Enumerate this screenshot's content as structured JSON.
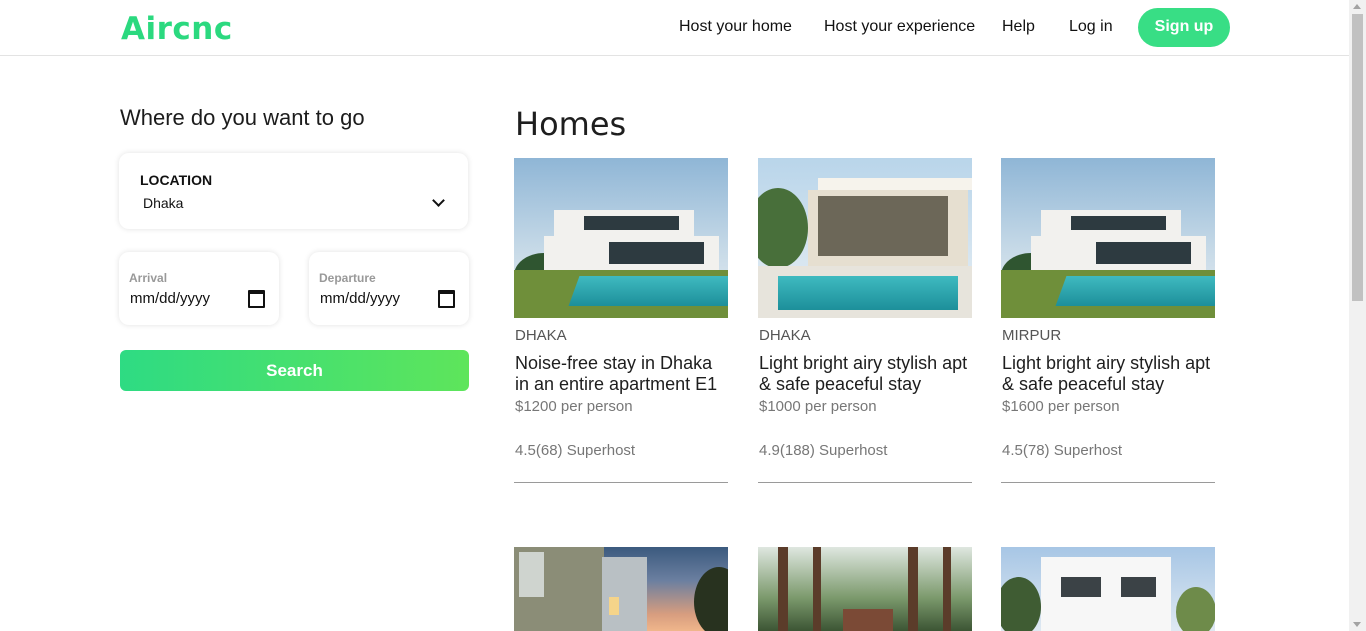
{
  "header": {
    "logo": "Aircnc",
    "nav": {
      "host_home": "Host your home",
      "host_experience": "Host your experience",
      "help": "Help",
      "login": "Log in",
      "signup": "Sign up"
    },
    "brand_color": "#2bd97f"
  },
  "search": {
    "title": "Where do you want to go",
    "location_label": "LOCATION",
    "location_value": "Dhaka",
    "arrival_label": "Arrival",
    "arrival_value": "mm/dd/yyyy",
    "departure_label": "Departure",
    "departure_value": "mm/dd/yyyy",
    "button_label": "Search"
  },
  "main": {
    "title": "Homes",
    "cards": [
      {
        "location": "DHAKA",
        "title": "Noise-free stay in Dhaka in an entire apartment E1",
        "price": "$1200 per person",
        "rating": "4.5(68) Superhost"
      },
      {
        "location": "DHAKA",
        "title": "Light bright airy stylish apt & safe peaceful stay",
        "price": "$1000 per person",
        "rating": "4.9(188) Superhost"
      },
      {
        "location": "MIRPUR",
        "title": "Light bright airy stylish apt & safe peaceful stay",
        "price": "$1600 per person",
        "rating": "4.5(78) Superhost"
      }
    ]
  }
}
